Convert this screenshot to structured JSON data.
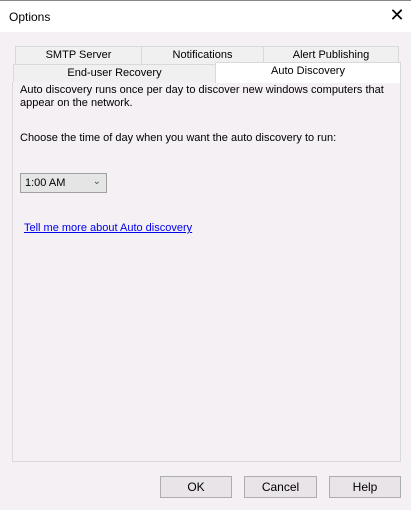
{
  "window": {
    "title": "Options",
    "close_icon": "close-icon"
  },
  "tabs": {
    "row1": [
      "SMTP Server",
      "Notifications",
      "Alert Publishing"
    ],
    "row2": [
      "End-user Recovery",
      "Auto Discovery"
    ],
    "selected": "Auto Discovery"
  },
  "content": {
    "description": "Auto discovery runs once per day to discover new windows computers that appear on the network.",
    "choose_label": "Choose the time of day when you want the auto discovery to run:",
    "time_value": "1:00 AM",
    "link": "Tell me more about Auto discovery"
  },
  "buttons": {
    "ok": "OK",
    "cancel": "Cancel",
    "help": "Help"
  }
}
